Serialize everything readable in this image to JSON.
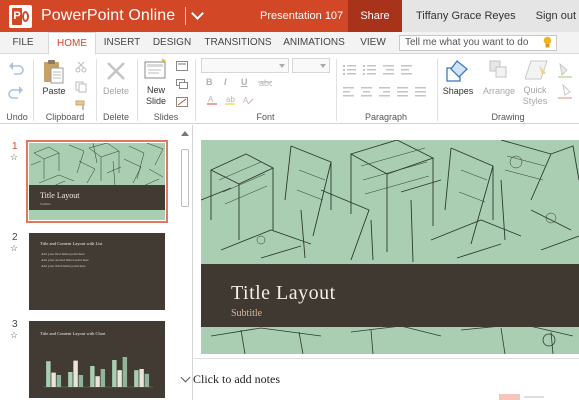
{
  "titlebar": {
    "app_name": "PowerPoint Online",
    "doc_name": "Presentation 107",
    "share_label": "Share",
    "user_name": "Tiffany Grace Reyes",
    "signout_label": "Sign out",
    "accent": "#d24726"
  },
  "tabs": [
    "FILE",
    "HOME",
    "INSERT",
    "DESIGN",
    "TRANSITIONS",
    "ANIMATIONS",
    "VIEW"
  ],
  "active_tab": "HOME",
  "tell_me": {
    "placeholder": "Tell me what you want to do"
  },
  "ribbon": {
    "groups": {
      "undo": "Undo",
      "clipboard": "Clipboard",
      "delete": "Delete",
      "slides": "Slides",
      "font": "Font",
      "paragraph": "Paragraph",
      "drawing": "Drawing"
    },
    "buttons": {
      "paste": "Paste",
      "delete": "Delete",
      "new_slide_1": "New",
      "new_slide_2": "Slide",
      "shapes": "Shapes",
      "arrange": "Arrange",
      "quick_styles_1": "Quick",
      "quick_styles_2": "Styles"
    },
    "format": {
      "bold": "B",
      "italic": "I",
      "underline": "U"
    }
  },
  "slides": [
    {
      "number": "1",
      "title": "Title Layout",
      "subtitle": "Subtitle"
    },
    {
      "number": "2",
      "title": "Title and Content Layout with List",
      "bullets": [
        "Add your first bullet point here",
        "Add your second bullet point here",
        "Add your third bullet point here"
      ]
    },
    {
      "number": "3",
      "title": "Title and Content Layout with Chart"
    }
  ],
  "slide3_chart_data": {
    "type": "bar",
    "categories": [
      "1",
      "2",
      "3",
      "4",
      "5"
    ],
    "series": [
      {
        "values": [
          4.3,
          2.5,
          3.5,
          4.5,
          2.8
        ]
      },
      {
        "values": [
          2.4,
          4.4,
          1.8,
          2.8,
          3.0
        ]
      },
      {
        "values": [
          2.0,
          2.0,
          3.0,
          5.0,
          2.2
        ]
      }
    ],
    "ylim": [
      0,
      6
    ]
  },
  "main_slide": {
    "title": "Title Layout",
    "subtitle": "Subtitle"
  },
  "notes_placeholder": "Click to add notes",
  "colors": {
    "slide_band": "#413b33",
    "slide_bg": "#a9ceb2",
    "selected_outline": "#e0785d"
  }
}
